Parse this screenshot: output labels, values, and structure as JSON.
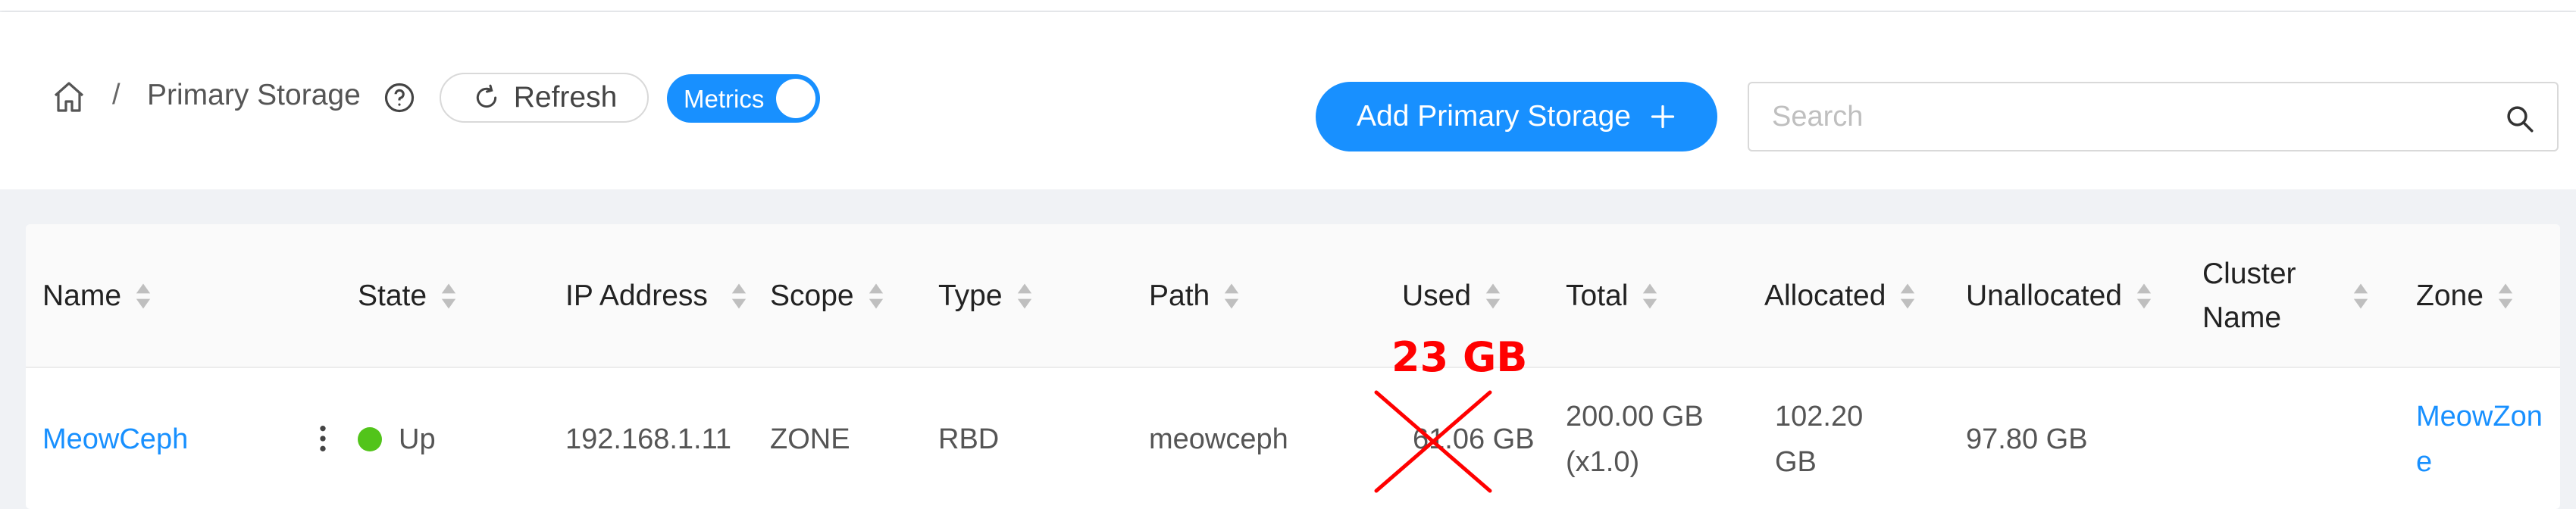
{
  "breadcrumb": {
    "current": "Primary Storage",
    "separator": "/"
  },
  "toolbar": {
    "refresh_label": "Refresh",
    "metrics_label": "Metrics",
    "metrics_on": true
  },
  "actions": {
    "add_label": "Add Primary Storage"
  },
  "search": {
    "placeholder": "Search",
    "value": ""
  },
  "table": {
    "columns": {
      "name": "Name",
      "state": "State",
      "ip": "IP Address",
      "scope": "Scope",
      "type": "Type",
      "path": "Path",
      "used": "Used",
      "total": "Total",
      "allocated": "Allocated",
      "unallocated": "Unallocated",
      "cluster": "Cluster Name",
      "zone": "Zone"
    },
    "rows": [
      {
        "name": "MeowCeph",
        "state": "Up",
        "ip": "192.168.1.11",
        "scope": "ZONE",
        "type": "RBD",
        "path": "meowceph",
        "used": "61.06 GB",
        "total": "200.00 GB (x1.0)",
        "allocated": "102.20 GB",
        "unallocated": "97.80 GB",
        "cluster": "",
        "zone": "MeowZone"
      }
    ]
  },
  "annotation": {
    "text": "23 GB",
    "color": "#ff0000"
  },
  "colors": {
    "accent": "#1890ff",
    "status_up": "#52c41a"
  }
}
